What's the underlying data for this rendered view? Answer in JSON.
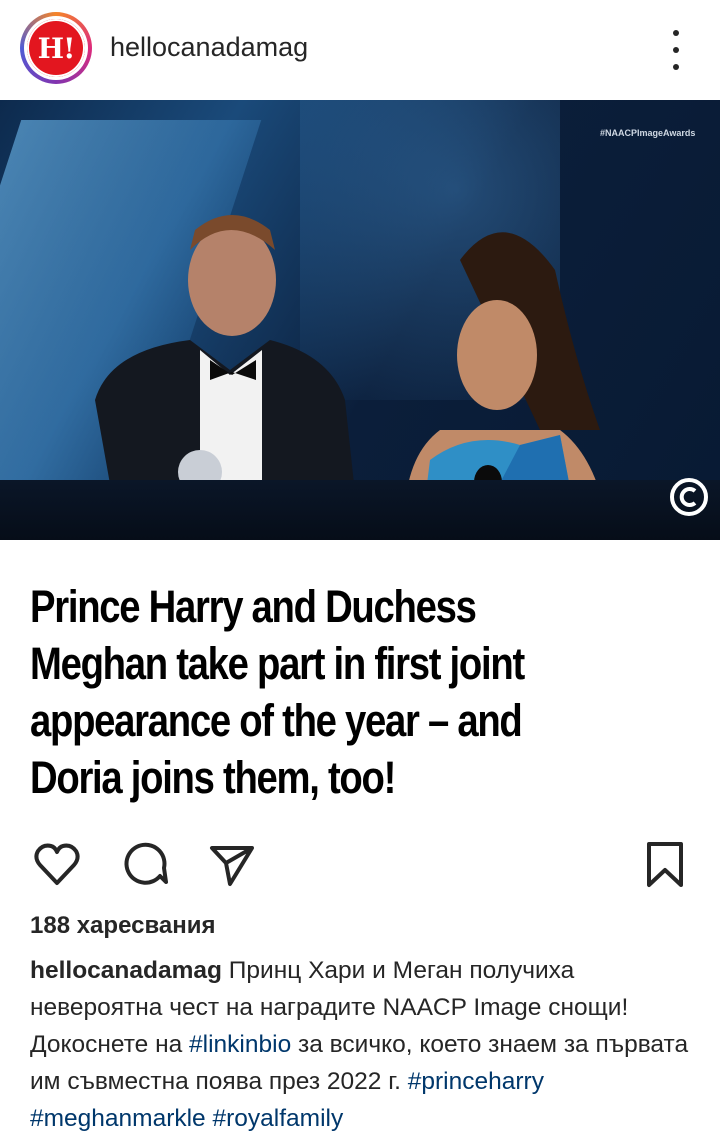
{
  "post": {
    "username": "hellocanadamag",
    "avatar_text": "H!",
    "photo": {
      "overlay_hashtag": "#NAACPImageAwards"
    },
    "headline_lines": [
      "Prince Harry and Duchess",
      "Meghan take part in first joint",
      "appearance of the year – and",
      "Doria joins them, too!"
    ],
    "actions": {
      "like": "heart-icon",
      "comment": "comment-icon",
      "share": "send-icon",
      "save": "bookmark-icon"
    },
    "likes_text": "188 харесвания",
    "caption": {
      "user": "hellocanadamag",
      "text_1": " Принц Хари и Меган получиха невероятна чест на наградите NAACP Image снощи! Докоснете на ",
      "tag_1": "#linkinbio",
      "text_2": " за всичко, което знаем за първата им съвместна поява през 2022 г. ",
      "tag_2": "#princeharry",
      "tag_3": "#meghanmarkle",
      "tag_4": "#royalfamily"
    }
  },
  "colors": {
    "link": "#00376b",
    "brand_red": "#e3161f",
    "text": "#262626"
  }
}
